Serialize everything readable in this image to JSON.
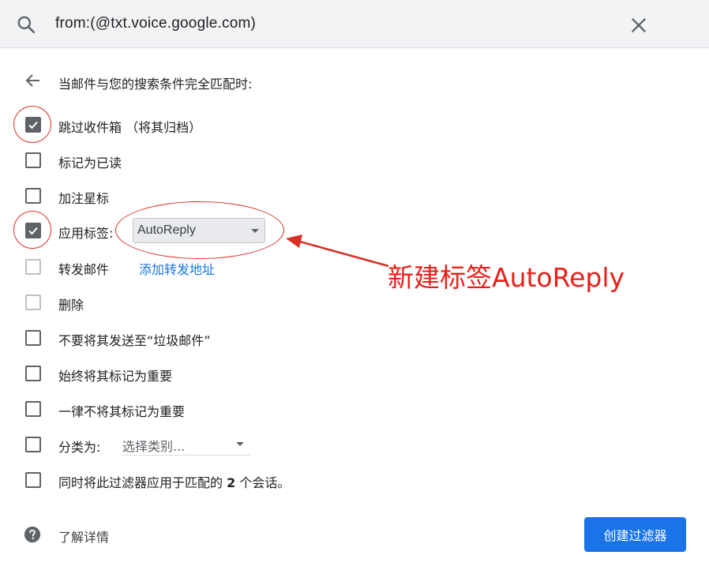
{
  "search": {
    "query": "from:(@txt.voice.google.com)",
    "search_icon": "search-icon",
    "close_icon": "close-icon"
  },
  "header": {
    "back_icon": "arrow-left-icon",
    "title": "当邮件与您的搜索条件完全匹配时:"
  },
  "options": {
    "skip_inbox": {
      "label": "跳过收件箱 （将其归档）",
      "checked": true
    },
    "mark_read": {
      "label": "标记为已读",
      "checked": false
    },
    "star": {
      "label": "加注星标",
      "checked": false
    },
    "apply_label": {
      "label": "应用标签:",
      "checked": true,
      "selected": "AutoReply"
    },
    "forward": {
      "label": "转发邮件",
      "checked": false,
      "disabled": true,
      "link": "添加转发地址"
    },
    "delete": {
      "label": "删除",
      "checked": false,
      "disabled": true
    },
    "never_spam": {
      "label": "不要将其发送至“垃圾邮件”",
      "checked": false
    },
    "always_important": {
      "label": "始终将其标记为重要",
      "checked": false
    },
    "never_important": {
      "label": "一律不将其标记为重要",
      "checked": false
    },
    "categorize": {
      "label": "分类为:",
      "checked": false,
      "selected": "选择类别..."
    },
    "also_apply": {
      "label_prefix": "同时将此过滤器应用于匹配的 ",
      "count": "2",
      "label_suffix": " 个会话。",
      "checked": false
    }
  },
  "annotation": {
    "text": "新建标签AutoReply",
    "color": "#e8201a"
  },
  "footer": {
    "help_icon": "help-circle-icon",
    "learn_more": "了解详情",
    "create_button": "创建过滤器"
  },
  "colors": {
    "accent": "#1a73e8",
    "checkbox": "#5f6368",
    "annotation": "#d93025"
  }
}
